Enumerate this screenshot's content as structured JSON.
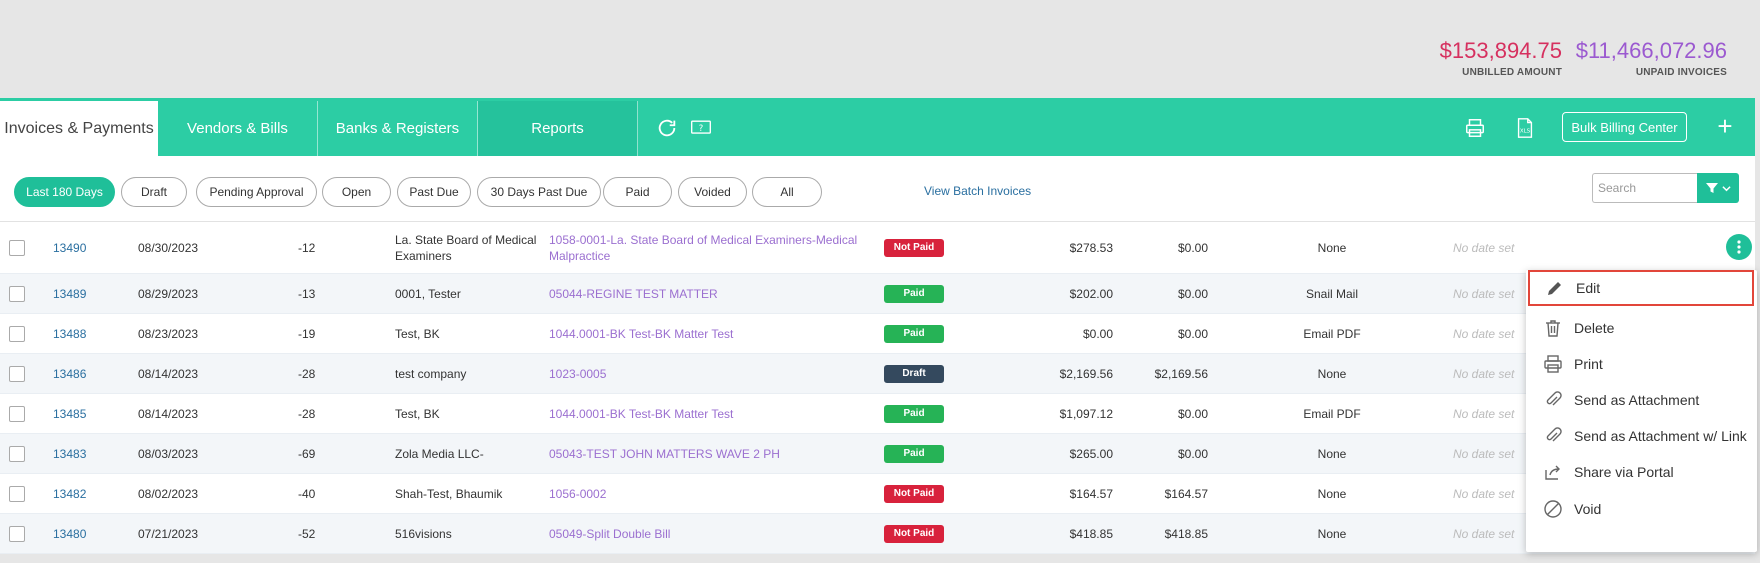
{
  "summary": {
    "unbilled_amount": "$153,894.75",
    "unbilled_label": "UNBILLED AMOUNT",
    "unpaid_invoices": "$11,466,072.96",
    "unpaid_label": "UNPAID INVOICES"
  },
  "tabs": [
    {
      "label": "Invoices & Payments",
      "active": true
    },
    {
      "label": "Vendors & Bills",
      "active": false
    },
    {
      "label": "Banks & Registers",
      "active": false
    },
    {
      "label": "Reports",
      "active": false
    }
  ],
  "toolbar": {
    "bulk_billing_label": "Bulk Billing Center",
    "plus_label": "+",
    "icons": [
      "refresh-icon",
      "help-icon",
      "print-icon",
      "xls-export-icon"
    ]
  },
  "filters": {
    "chips": [
      "Last 180 Days",
      "Draft",
      "Pending Approval",
      "Open",
      "Past Due",
      "30 Days Past Due",
      "Paid",
      "Voided",
      "All"
    ],
    "active": "Last 180 Days",
    "batch_link": "View Batch Invoices",
    "search_placeholder": "Search"
  },
  "invoices": [
    {
      "number": "13490",
      "date": "08/30/2023",
      "days": "-12",
      "client": "La. State Board of Medical Examiners",
      "matter": "1058-0001-La. State Board of Medical Examiners-Medical Malpractice",
      "status": "Not Paid",
      "amount": "$278.53",
      "balance": "$0.00",
      "delivery": "None",
      "due": "No date set"
    },
    {
      "number": "13489",
      "date": "08/29/2023",
      "days": "-13",
      "client": "0001, Tester",
      "matter": "05044-REGINE TEST MATTER",
      "status": "Paid",
      "amount": "$202.00",
      "balance": "$0.00",
      "delivery": "Snail Mail",
      "due": "No date set"
    },
    {
      "number": "13488",
      "date": "08/23/2023",
      "days": "-19",
      "client": "Test, BK",
      "matter": "1044.0001-BK Test-BK Matter Test",
      "status": "Paid",
      "amount": "$0.00",
      "balance": "$0.00",
      "delivery": "Email PDF",
      "due": "No date set"
    },
    {
      "number": "13486",
      "date": "08/14/2023",
      "days": "-28",
      "client": "test company",
      "matter": "1023-0005",
      "status": "Draft",
      "amount": "$2,169.56",
      "balance": "$2,169.56",
      "delivery": "None",
      "due": "No date set"
    },
    {
      "number": "13485",
      "date": "08/14/2023",
      "days": "-28",
      "client": "Test, BK",
      "matter": "1044.0001-BK Test-BK Matter Test",
      "status": "Paid",
      "amount": "$1,097.12",
      "balance": "$0.00",
      "delivery": "Email PDF",
      "due": "No date set"
    },
    {
      "number": "13483",
      "date": "08/03/2023",
      "days": "-69",
      "client": "Zola Media LLC-",
      "matter": "05043-TEST JOHN MATTERS WAVE 2 PH",
      "status": "Paid",
      "amount": "$265.00",
      "balance": "$0.00",
      "delivery": "None",
      "due": "No date set"
    },
    {
      "number": "13482",
      "date": "08/02/2023",
      "days": "-40",
      "client": "Shah-Test, Bhaumik",
      "matter": "1056-0002",
      "status": "Not Paid",
      "amount": "$164.57",
      "balance": "$164.57",
      "delivery": "None",
      "due": "No date set"
    },
    {
      "number": "13480",
      "date": "07/21/2023",
      "days": "-52",
      "client": "516visions",
      "matter": "05049-Split Double Bill",
      "status": "Not Paid",
      "amount": "$418.85",
      "balance": "$418.85",
      "delivery": "None",
      "due": "No date set"
    }
  ],
  "context_menu": {
    "items": [
      {
        "label": "Edit",
        "icon": "pencil-icon",
        "selected": true
      },
      {
        "label": "Delete",
        "icon": "trash-icon",
        "selected": false
      },
      {
        "label": "Print",
        "icon": "print-icon",
        "selected": false
      },
      {
        "label": "Send as Attachment",
        "icon": "paperclip-icon",
        "selected": false
      },
      {
        "label": "Send as Attachment w/ Link",
        "icon": "paperclip-icon",
        "selected": false
      },
      {
        "label": "Share via Portal",
        "icon": "share-icon",
        "selected": false
      },
      {
        "label": "Void",
        "icon": "void-icon",
        "selected": false
      }
    ]
  },
  "colors": {
    "accent": "#2ccda4",
    "unbilled": "#d6305f",
    "unpaid": "#9b59d0",
    "paid_badge": "#26b356",
    "not_paid_badge": "#d8223c",
    "draft_badge": "#34495e",
    "link": "#2a6fa0",
    "matter_link": "#9b6fd0"
  }
}
